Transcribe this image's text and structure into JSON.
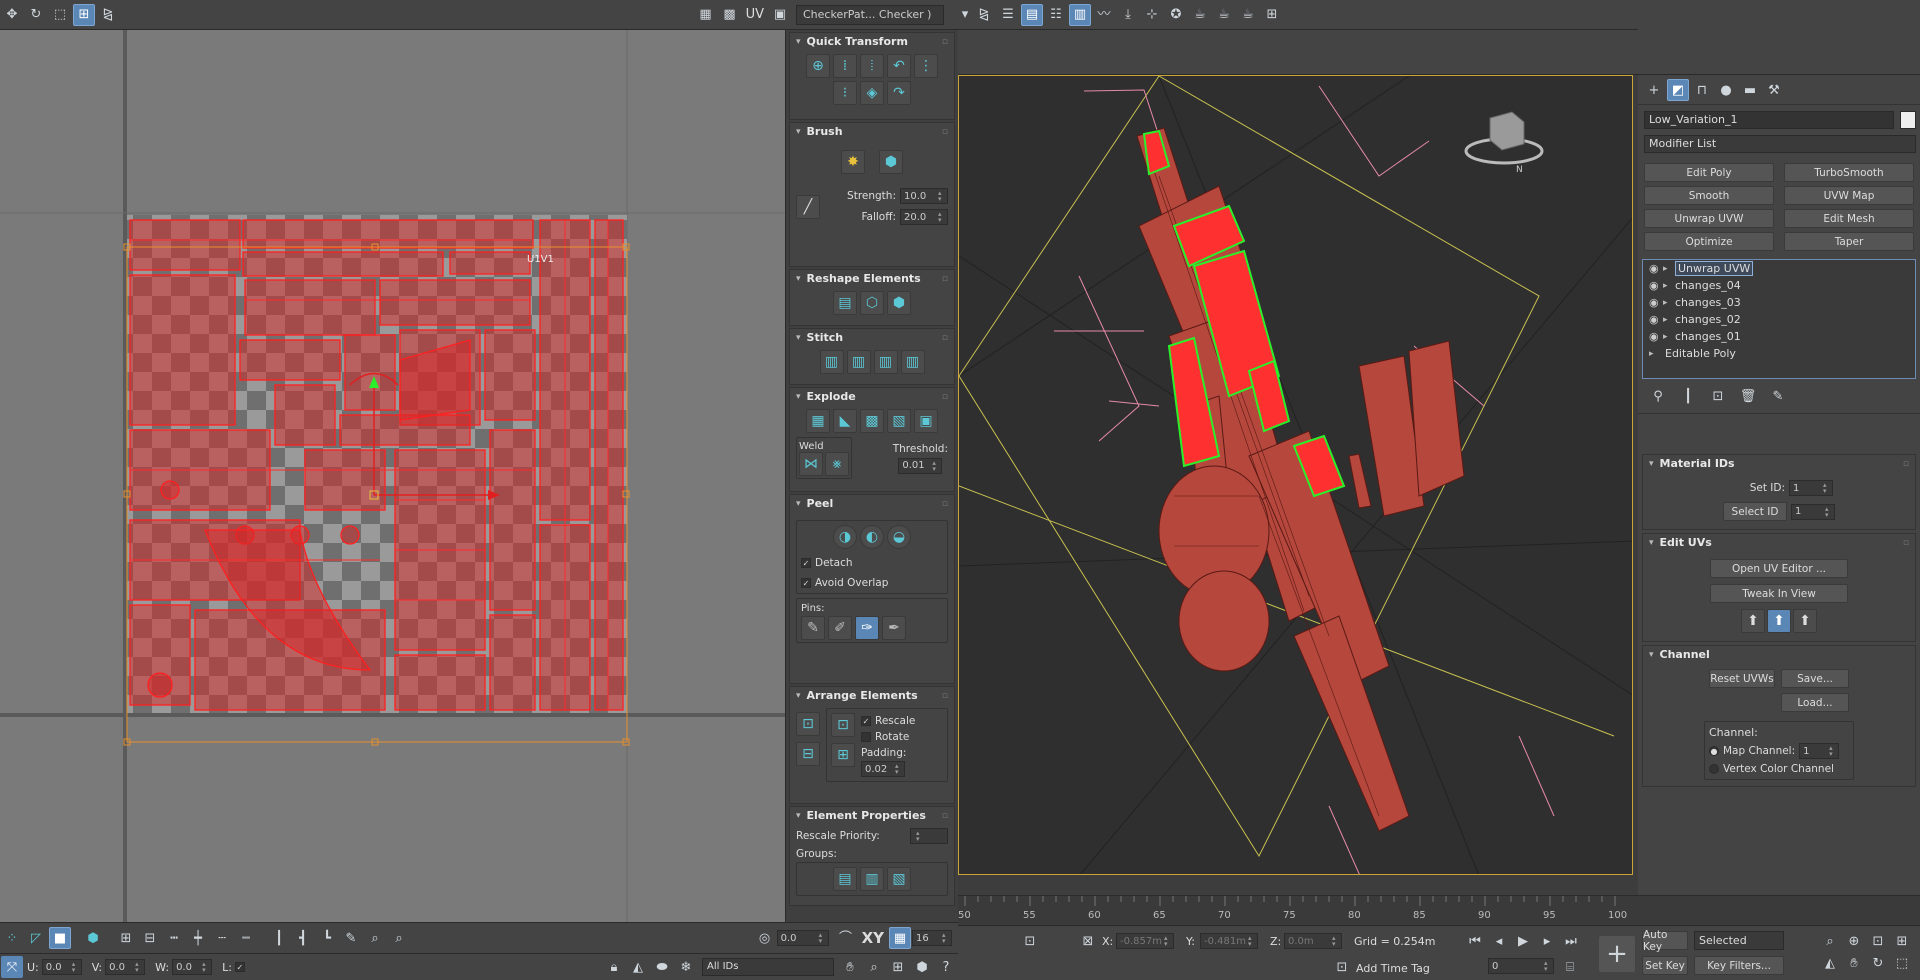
{
  "uv_editor": {
    "checker_dropdown": "CheckerPat... Checker )",
    "uv_label": "UV",
    "tile_label": "U1V1",
    "panels": {
      "quick_transform": "Quick Transform",
      "brush": "Brush",
      "brush_strength_label": "Strength:",
      "brush_strength": "10.0",
      "brush_falloff_label": "Falloff:",
      "brush_falloff": "20.0",
      "reshape": "Reshape Elements",
      "stitch": "Stitch",
      "explode": "Explode",
      "weld_label": "Weld",
      "threshold_label": "Threshold:",
      "threshold": "0.01",
      "peel": "Peel",
      "detach_label": "Detach",
      "avoid_overlap_label": "Avoid Overlap",
      "pins_label": "Pins:",
      "arrange": "Arrange Elements",
      "rescale_label": "Rescale",
      "rotate_label": "Rotate",
      "padding_label": "Padding:",
      "padding": "0.02",
      "element_properties": "Element Properties",
      "rescale_priority_label": "Rescale Priority:",
      "groups_label": "Groups:"
    },
    "bottom": {
      "val_a": "0.0",
      "xy_label": "XY",
      "val_b": "16",
      "u_label": "U:",
      "u_value": "0.0",
      "v_label": "V:",
      "v_value": "0.0",
      "w_label": "W:",
      "w_value": "0.0",
      "l_label": "L:",
      "ids_dropdown": "All IDs"
    }
  },
  "command_panel": {
    "object_name": "Low_Variation_1",
    "modifier_list": "Modifier List",
    "modifier_buttons": [
      "Edit Poly",
      "TurboSmooth",
      "Smooth",
      "UVW Map",
      "Unwrap UVW",
      "Edit Mesh",
      "Optimize",
      "Taper"
    ],
    "stack": [
      "Unwrap UVW",
      "changes_04",
      "changes_03",
      "changes_02",
      "changes_01",
      "Editable Poly"
    ],
    "material_ids": "Material IDs",
    "set_id_label": "Set ID:",
    "set_id": "1",
    "select_id_label": "Select ID",
    "select_id": "1",
    "edit_uvs": "Edit UVs",
    "open_uv_editor": "Open UV Editor ...",
    "tweak_in_view": "Tweak In View",
    "channel": "Channel",
    "reset_uvws": "Reset UVWs",
    "save": "Save...",
    "load": "Load...",
    "channel_label": "Channel:",
    "map_channel_label": "Map Channel:",
    "map_channel": "1",
    "vertex_color_label": "Vertex Color Channel"
  },
  "timeline": {
    "ticks": [
      "50",
      "55",
      "60",
      "65",
      "70",
      "75",
      "80",
      "85",
      "90",
      "95",
      "100"
    ]
  },
  "status": {
    "x_label": "X:",
    "x_value": "-0.857m",
    "y_label": "Y:",
    "y_value": "-0.481m",
    "z_label": "Z:",
    "z_value": "0.0m",
    "grid": "Grid = 0.254m",
    "add_time_tag": "Add Time Tag",
    "frame": "0",
    "auto_key": "Auto Key",
    "selected": "Selected",
    "set_key": "Set Key",
    "key_filters": "Key Filters..."
  },
  "colors": {
    "uv_red": "#e02020",
    "selection_green": "#2bef2b",
    "mesh": "#b5473d",
    "accent": "#5b87b6"
  }
}
